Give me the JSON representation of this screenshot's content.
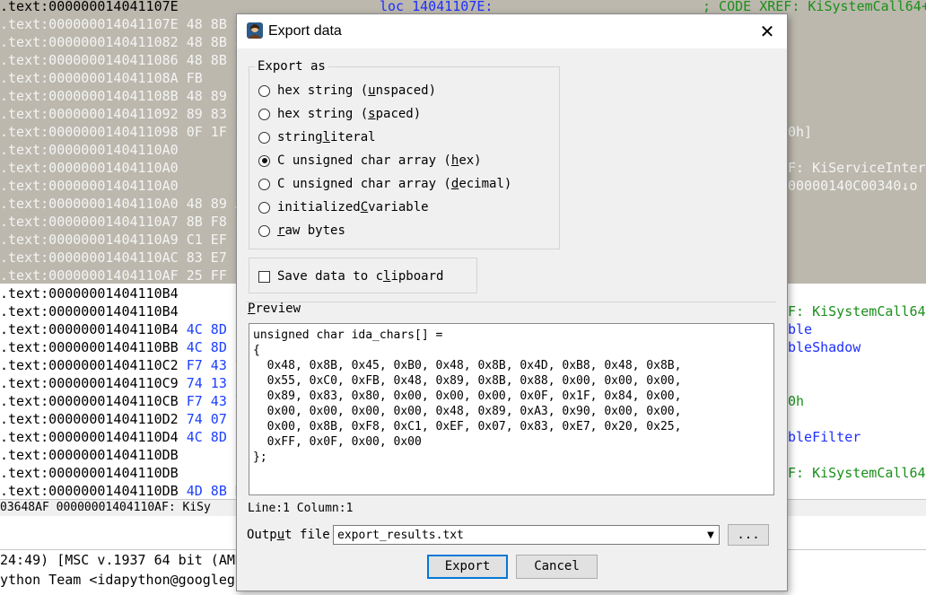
{
  "background": {
    "lines": [
      {
        "addr": ".text:000000014041107E",
        "hex": "",
        "sel": false
      },
      {
        "addr": ".text:000000014041107E",
        "hex": "48 8B 4",
        "sel": true
      },
      {
        "addr": ".text:0000000140411082",
        "hex": "48 8B 4",
        "sel": true
      },
      {
        "addr": ".text:0000000140411086",
        "hex": "48 8B 9",
        "sel": true
      },
      {
        "addr": ".text:000000014041108A",
        "hex": "FB",
        "sel": true
      },
      {
        "addr": ".text:000000014041108B",
        "hex": "48 89 8",
        "sel": true
      },
      {
        "addr": ".text:0000000140411092",
        "hex": "89 83 8",
        "sel": true
      },
      {
        "addr": ".text:0000000140411098",
        "hex": "0F 1F 8",
        "sel": true
      },
      {
        "addr": ".text:00000001404110A0",
        "hex": "",
        "sel": true
      },
      {
        "addr": ".text:00000001404110A0",
        "hex": "",
        "sel": true
      },
      {
        "addr": ".text:00000001404110A0",
        "hex": "",
        "sel": true
      },
      {
        "addr": ".text:00000001404110A0",
        "hex": "48 89 A",
        "sel": true
      },
      {
        "addr": ".text:00000001404110A7",
        "hex": "8B F8",
        "sel": true
      },
      {
        "addr": ".text:00000001404110A9",
        "hex": "C1 EF 0",
        "sel": true
      },
      {
        "addr": ".text:00000001404110AC",
        "hex": "83 E7 2",
        "sel": true
      },
      {
        "addr": ".text:00000001404110AF",
        "hex": "25 FF 0",
        "sel": true
      },
      {
        "addr": ".text:00000001404110B4",
        "hex": "",
        "sel": false
      },
      {
        "addr": ".text:00000001404110B4",
        "hex": "",
        "sel": false
      },
      {
        "addr": ".text:00000001404110B4",
        "hex": "4C 8D 1",
        "sel": false
      },
      {
        "addr": ".text:00000001404110BB",
        "hex": "4C 8D 1",
        "sel": false
      },
      {
        "addr": ".text:00000001404110C2",
        "hex": "F7 43 7",
        "sel": false
      },
      {
        "addr": ".text:00000001404110C9",
        "hex": "74 13",
        "sel": false
      },
      {
        "addr": ".text:00000001404110CB",
        "hex": "F7 43 7",
        "sel": false
      },
      {
        "addr": ".text:00000001404110D2",
        "hex": "74 07",
        "sel": false
      },
      {
        "addr": ".text:00000001404110D4",
        "hex": "4C 8D 1",
        "sel": false
      },
      {
        "addr": ".text:00000001404110DB",
        "hex": "",
        "sel": false
      },
      {
        "addr": ".text:00000001404110DB",
        "hex": "",
        "sel": false
      },
      {
        "addr": ".text:00000001404110DB",
        "hex": "4D 8B D",
        "sel": false
      }
    ],
    "label_loc": "loc_14041107E:",
    "xref_top": "; CODE XREF: KiSystemCall64+",
    "right_0h_1": "0h]",
    "right_xref2": "F: KiServiceIntern",
    "right_addr": "00000140C00340↓o",
    "right_xref3": "F: KiSystemCall64+",
    "right_ble": "ble",
    "right_bleShadow": "bleShadow",
    "right_0h_2": "0h",
    "right_bleFilter": "bleFilter",
    "right_xref4": "F: KiSystemCall64+",
    "status_text": "03648AF 00000001404110AF: KiSy",
    "output_line1": "24:49) [MSC v.1937 64 bit (AMD",
    "output_line2": "ython Team <idapython@googlegr"
  },
  "dialog": {
    "title": "Export data",
    "close_glyph": "✕",
    "export_as_label": "Export as",
    "options": [
      {
        "pre": "hex string (",
        "u": "u",
        "post": "nspaced)",
        "checked": false
      },
      {
        "pre": "hex string (",
        "u": "s",
        "post": "paced)",
        "checked": false
      },
      {
        "pre": "string ",
        "u": "l",
        "post": "iteral",
        "checked": false
      },
      {
        "pre": "C unsigned char array (",
        "u": "h",
        "post": "ex)",
        "checked": true
      },
      {
        "pre": "C unsigned char array (",
        "u": "d",
        "post": "ecimal)",
        "checked": false
      },
      {
        "pre": "initialized ",
        "u": "C",
        "post": " variable",
        "checked": false
      },
      {
        "pre": "",
        "u": "r",
        "post": "aw bytes",
        "checked": false
      }
    ],
    "clipboard": {
      "pre": "Save data to c",
      "u": "l",
      "post": "ipboard",
      "checked": false
    },
    "preview_label_u": "P",
    "preview_label_rest": "review",
    "preview_text": "unsigned char ida_chars[] =\n{\n  0x48, 0x8B, 0x45, 0xB0, 0x48, 0x8B, 0x4D, 0xB8, 0x48, 0x8B,\n  0x55, 0xC0, 0xFB, 0x48, 0x89, 0x8B, 0x88, 0x00, 0x00, 0x00,\n  0x89, 0x83, 0x80, 0x00, 0x00, 0x00, 0x0F, 0x1F, 0x84, 0x00,\n  0x00, 0x00, 0x00, 0x00, 0x48, 0x89, 0xA3, 0x90, 0x00, 0x00,\n  0x00, 0x8B, 0xF8, 0xC1, 0xEF, 0x07, 0x83, 0xE7, 0x20, 0x25,\n  0xFF, 0x0F, 0x00, 0x00\n};",
    "line_info": "Line:1  Column:1",
    "output_file_label_pre": "Outp",
    "output_file_label_u": "u",
    "output_file_label_post": "t file",
    "output_file_value": "export_results.txt",
    "browse_label": "...",
    "export_button": "Export",
    "cancel_button": "Cancel"
  },
  "colors": {
    "selection": "#bcb8ad",
    "hex_blue": "#1e40ff",
    "xref_green": "#1a8f1a",
    "focus_border": "#0078d7"
  }
}
